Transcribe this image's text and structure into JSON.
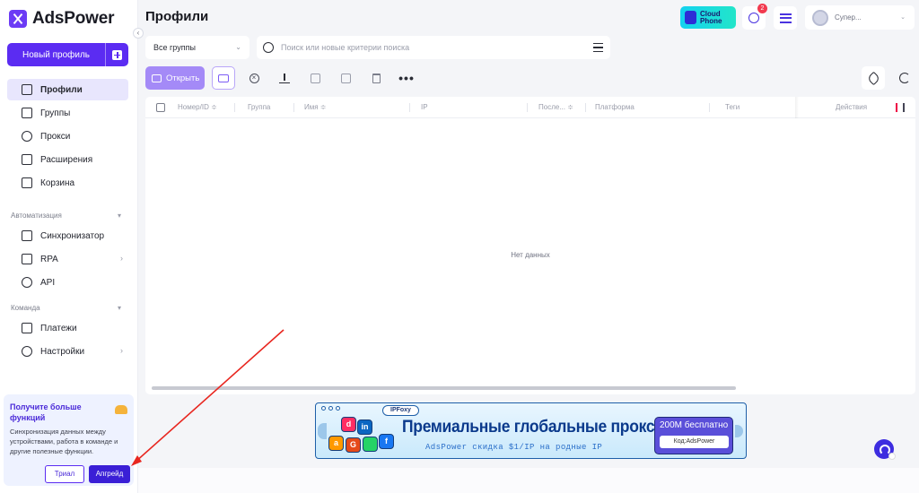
{
  "app": {
    "brand": "AdsPower",
    "collapse_glyph": "‹"
  },
  "sidebar": {
    "new_profile_label": "Новый профиль",
    "items": [
      {
        "label": "Профили",
        "icon": "profiles-icon",
        "active": true
      },
      {
        "label": "Группы",
        "icon": "folder-icon"
      },
      {
        "label": "Прокси",
        "icon": "globe-icon"
      },
      {
        "label": "Расширения",
        "icon": "puzzle-icon"
      },
      {
        "label": "Корзина",
        "icon": "trash-icon"
      }
    ],
    "automation": {
      "label": "Автоматизация",
      "items": [
        {
          "label": "Синхронизатор",
          "icon": "sync-icon"
        },
        {
          "label": "RPA",
          "icon": "robot-icon"
        },
        {
          "label": "API",
          "icon": "plug-icon"
        }
      ]
    },
    "team": {
      "label": "Команда",
      "items": [
        {
          "label": "Платежи",
          "icon": "payment-icon"
        },
        {
          "label": "Настройки",
          "icon": "users-icon"
        }
      ]
    },
    "promo": {
      "title": "Получите больше функций",
      "text": "Синхронизация данных между устройствами, работа в команде и другие полезные функции.",
      "trial_label": "Триал",
      "upgrade_label": "Апгрейд"
    }
  },
  "header": {
    "title": "Профили",
    "cloud_phone": "Cloud Phone",
    "notification_count": "2",
    "user_name": "Супер..."
  },
  "filters": {
    "group_select": "Все группы",
    "search_placeholder": "Поиск или новые критерии поиска"
  },
  "toolbar": {
    "open_label": "Открыть",
    "more_glyph": "•••"
  },
  "table": {
    "columns": [
      "Номер/ID ≑",
      "Группа",
      "Имя ≑",
      "IP",
      "После... ≑",
      "Платформа",
      "Теги",
      "Действия"
    ],
    "rows": [],
    "empty_text": "Нет данных"
  },
  "banner": {
    "brand": "IPFoxy",
    "headline": "Премиальные глобальные прокси",
    "subline": "AdsPower скидка $1/IP на родные IP",
    "offer_title": "200М бесплатно",
    "offer_code": "Код:AdsPower",
    "apps": [
      "d",
      "in",
      "a",
      "G",
      "f"
    ]
  },
  "colors": {
    "accent": "#5b2cf2",
    "annotation_arrow": "#e8261f"
  }
}
